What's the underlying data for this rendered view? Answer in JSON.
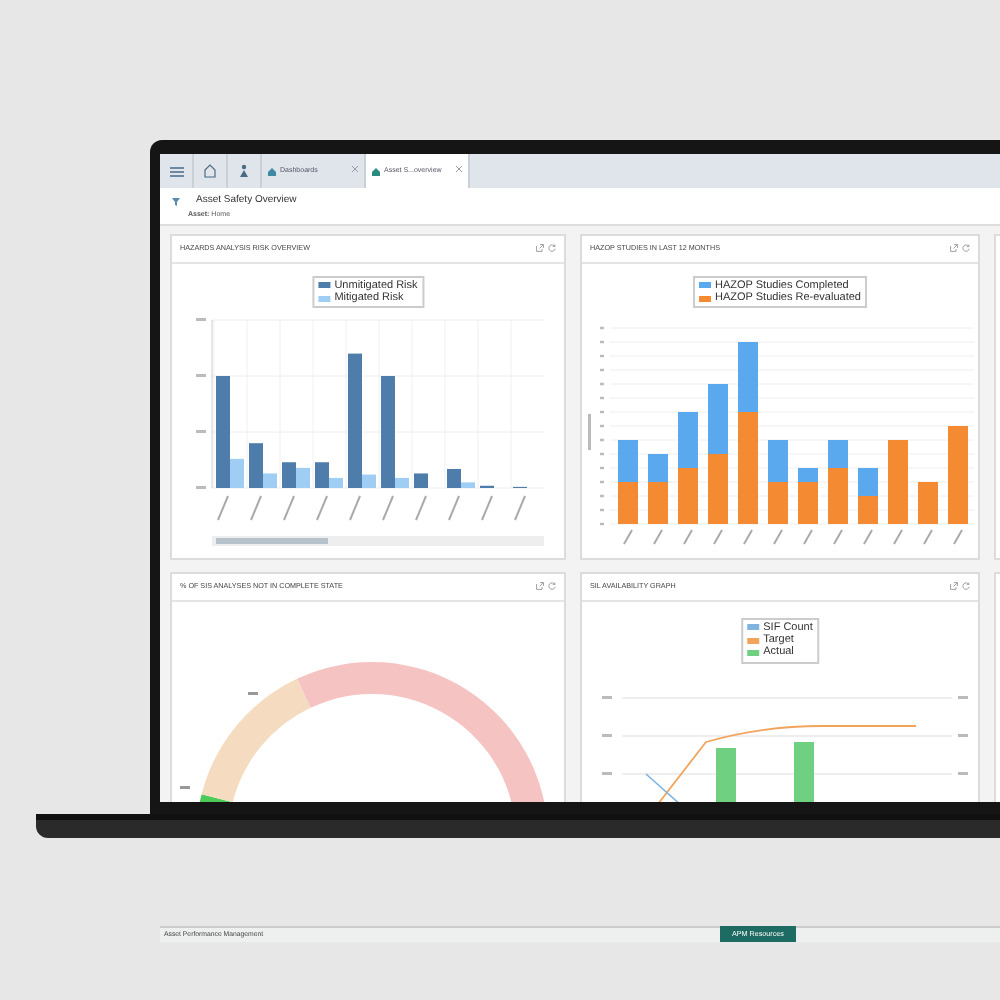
{
  "tab_bar": {
    "tabs": [
      {
        "label": "Dashboards",
        "selected": false
      },
      {
        "label": "Asset S...overview",
        "selected": true
      }
    ]
  },
  "page": {
    "title": "Asset Safety Overview",
    "asset_label": "Asset:",
    "asset_value": "Home"
  },
  "cards": [
    {
      "title": "HAZARDS ANALYSIS RISK OVERVIEW",
      "kind": "risk-bars",
      "legend": [
        {
          "label": "Unmitigated Risk",
          "color": "#4e7cab"
        },
        {
          "label": "Mitigated Risk",
          "color": "#9fcdf3"
        }
      ]
    },
    {
      "title": "HAZOP STUDIES IN LAST 12 MONTHS",
      "kind": "stacked-bars",
      "legend": [
        {
          "label": "HAZOP Studies Completed",
          "color": "#5aa9ee"
        },
        {
          "label": "HAZOP Studies Re-evaluated",
          "color": "#f48b32"
        }
      ]
    },
    {
      "title": "% OF SIS ANALYSES NOT IN COMPLETE STATE",
      "kind": "gauge"
    },
    {
      "title": "SIL AVAILABILITY GRAPH",
      "kind": "combo",
      "legend": [
        {
          "label": "SIF Count",
          "color": "#7fb3e0"
        },
        {
          "label": "Target",
          "color": "#f3a45c"
        },
        {
          "label": "Actual",
          "color": "#6fd082"
        }
      ]
    }
  ],
  "footer": {
    "app_name": "Asset Performance Management",
    "button": "APM Resources"
  }
}
